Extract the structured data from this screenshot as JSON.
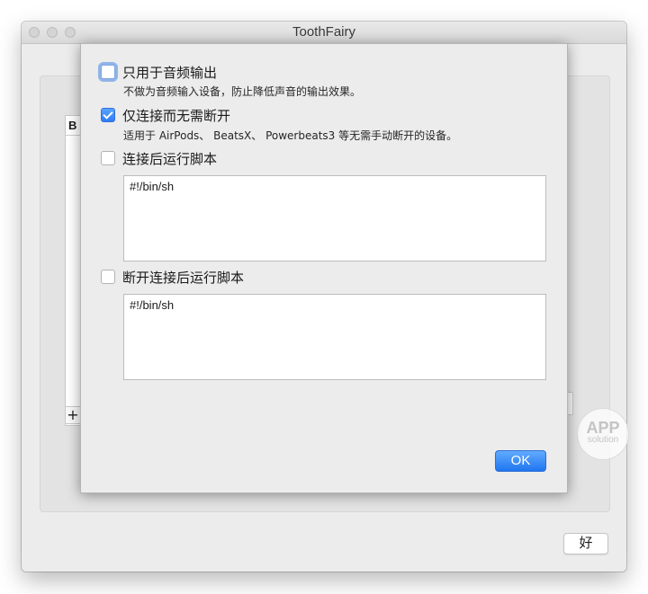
{
  "window": {
    "title": "ToothFairy",
    "ok_label": "好",
    "list_header_fragment": "B",
    "add_button": "+"
  },
  "watermark": {
    "line1": "APP",
    "line2": "solution"
  },
  "sheet": {
    "options": [
      {
        "label": "只用于音频输出",
        "checked": false,
        "description": "不做为音频输入设备，防止降低声音的输出效果。"
      },
      {
        "label": "仅连接而无需断开",
        "checked": true,
        "description": "适用于 AirPods、 BeatsX、 Powerbeats3 等无需手动断开的设备。"
      },
      {
        "label": "连接后运行脚本",
        "checked": false,
        "script": "#!/bin/sh"
      },
      {
        "label": "断开连接后运行脚本",
        "checked": false,
        "script": "#!/bin/sh"
      }
    ],
    "ok_label": "OK"
  },
  "colors": {
    "accent": "#2f7bf5",
    "window_bg": "#ececec",
    "focus_ring": "#5f96e6"
  }
}
